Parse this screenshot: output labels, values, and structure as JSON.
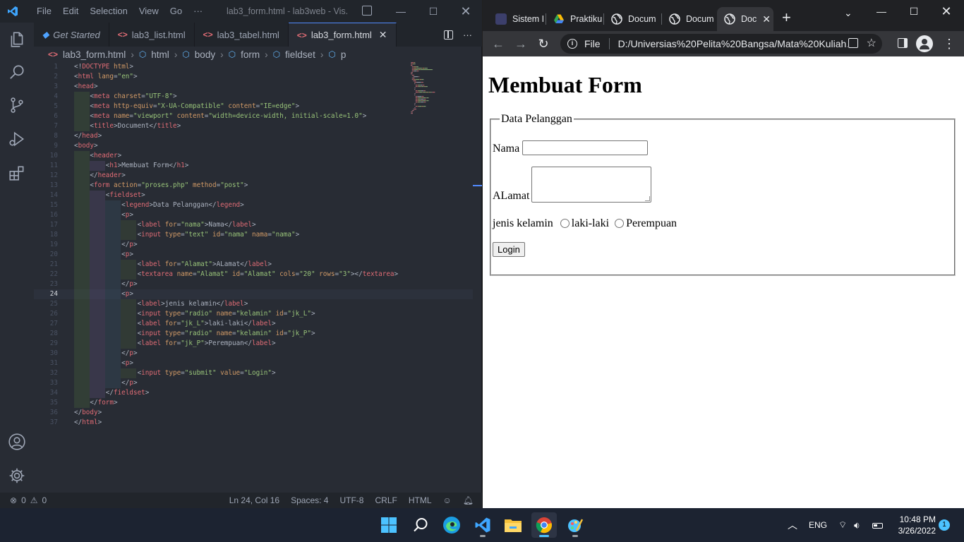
{
  "vscode": {
    "menu": [
      "File",
      "Edit",
      "Selection",
      "View",
      "Go",
      "···"
    ],
    "window_title": "lab3_form.html - lab3web - Vis...",
    "tabs": [
      {
        "label": "Get Started",
        "icon": "vscode-icon",
        "active": false
      },
      {
        "label": "lab3_list.html",
        "icon": "html-icon",
        "active": false
      },
      {
        "label": "lab3_tabel.html",
        "icon": "html-icon",
        "active": false
      },
      {
        "label": "lab3_form.html",
        "icon": "html-icon",
        "active": true
      }
    ],
    "breadcrumb": [
      "lab3_form.html",
      "html",
      "body",
      "form",
      "fieldset",
      "p"
    ],
    "active_line": 24,
    "code_lines": [
      [
        [
          "b",
          "<!"
        ],
        [
          "t",
          "DOCTYPE"
        ],
        [
          "x",
          " "
        ],
        [
          "a",
          "html"
        ],
        [
          "b",
          ">"
        ]
      ],
      [
        [
          "b",
          "<"
        ],
        [
          "t",
          "html"
        ],
        [
          "x",
          " "
        ],
        [
          "a",
          "lang"
        ],
        [
          "b",
          "="
        ],
        [
          "s",
          "\"en\""
        ],
        [
          "b",
          ">"
        ]
      ],
      [
        [
          "b",
          "<"
        ],
        [
          "t",
          "head"
        ],
        [
          "b",
          ">"
        ]
      ],
      [
        [
          "x",
          "    "
        ],
        [
          "b",
          "<"
        ],
        [
          "t",
          "meta"
        ],
        [
          "x",
          " "
        ],
        [
          "a",
          "charset"
        ],
        [
          "b",
          "="
        ],
        [
          "s",
          "\"UTF-8\""
        ],
        [
          "b",
          ">"
        ]
      ],
      [
        [
          "x",
          "    "
        ],
        [
          "b",
          "<"
        ],
        [
          "t",
          "meta"
        ],
        [
          "x",
          " "
        ],
        [
          "a",
          "http-equiv"
        ],
        [
          "b",
          "="
        ],
        [
          "s",
          "\"X-UA-Compatible\""
        ],
        [
          "x",
          " "
        ],
        [
          "a",
          "content"
        ],
        [
          "b",
          "="
        ],
        [
          "s",
          "\"IE=edge\""
        ],
        [
          "b",
          ">"
        ]
      ],
      [
        [
          "x",
          "    "
        ],
        [
          "b",
          "<"
        ],
        [
          "t",
          "meta"
        ],
        [
          "x",
          " "
        ],
        [
          "a",
          "name"
        ],
        [
          "b",
          "="
        ],
        [
          "s",
          "\"viewport\""
        ],
        [
          "x",
          " "
        ],
        [
          "a",
          "content"
        ],
        [
          "b",
          "="
        ],
        [
          "s",
          "\"width=device-width, initial-scale=1.0\""
        ],
        [
          "b",
          ">"
        ]
      ],
      [
        [
          "x",
          "    "
        ],
        [
          "b",
          "<"
        ],
        [
          "t",
          "title"
        ],
        [
          "b",
          ">"
        ],
        [
          "x",
          "Document"
        ],
        [
          "b",
          "</"
        ],
        [
          "t",
          "title"
        ],
        [
          "b",
          ">"
        ]
      ],
      [
        [
          "b",
          "</"
        ],
        [
          "t",
          "head"
        ],
        [
          "b",
          ">"
        ]
      ],
      [
        [
          "b",
          "<"
        ],
        [
          "t",
          "body"
        ],
        [
          "b",
          ">"
        ]
      ],
      [
        [
          "x",
          "    "
        ],
        [
          "b",
          "<"
        ],
        [
          "t",
          "header"
        ],
        [
          "b",
          ">"
        ]
      ],
      [
        [
          "x",
          "        "
        ],
        [
          "b",
          "<"
        ],
        [
          "t",
          "h1"
        ],
        [
          "b",
          ">"
        ],
        [
          "x",
          "Membuat Form"
        ],
        [
          "b",
          "</"
        ],
        [
          "t",
          "h1"
        ],
        [
          "b",
          ">"
        ]
      ],
      [
        [
          "x",
          "    "
        ],
        [
          "b",
          "</"
        ],
        [
          "t",
          "header"
        ],
        [
          "b",
          ">"
        ]
      ],
      [
        [
          "x",
          "    "
        ],
        [
          "b",
          "<"
        ],
        [
          "t",
          "form"
        ],
        [
          "x",
          " "
        ],
        [
          "a",
          "action"
        ],
        [
          "b",
          "="
        ],
        [
          "s",
          "\"proses.php\""
        ],
        [
          "x",
          " "
        ],
        [
          "a",
          "method"
        ],
        [
          "b",
          "="
        ],
        [
          "s",
          "\"post\""
        ],
        [
          "b",
          ">"
        ]
      ],
      [
        [
          "x",
          "        "
        ],
        [
          "b",
          "<"
        ],
        [
          "t",
          "fieldset"
        ],
        [
          "b",
          ">"
        ]
      ],
      [
        [
          "x",
          "            "
        ],
        [
          "b",
          "<"
        ],
        [
          "t",
          "legend"
        ],
        [
          "b",
          ">"
        ],
        [
          "x",
          "Data Pelanggan"
        ],
        [
          "b",
          "</"
        ],
        [
          "t",
          "legend"
        ],
        [
          "b",
          ">"
        ]
      ],
      [
        [
          "x",
          "            "
        ],
        [
          "b",
          "<"
        ],
        [
          "t",
          "p"
        ],
        [
          "b",
          ">"
        ]
      ],
      [
        [
          "x",
          "                "
        ],
        [
          "b",
          "<"
        ],
        [
          "t",
          "label"
        ],
        [
          "x",
          " "
        ],
        [
          "a",
          "for"
        ],
        [
          "b",
          "="
        ],
        [
          "s",
          "\"nama\""
        ],
        [
          "b",
          ">"
        ],
        [
          "x",
          "Nama"
        ],
        [
          "b",
          "</"
        ],
        [
          "t",
          "label"
        ],
        [
          "b",
          ">"
        ]
      ],
      [
        [
          "x",
          "                "
        ],
        [
          "b",
          "<"
        ],
        [
          "t",
          "input"
        ],
        [
          "x",
          " "
        ],
        [
          "a",
          "type"
        ],
        [
          "b",
          "="
        ],
        [
          "s",
          "\"text\""
        ],
        [
          "x",
          " "
        ],
        [
          "a",
          "id"
        ],
        [
          "b",
          "="
        ],
        [
          "s",
          "\"nama\""
        ],
        [
          "x",
          " "
        ],
        [
          "a",
          "nama"
        ],
        [
          "b",
          "="
        ],
        [
          "s",
          "\"nama\""
        ],
        [
          "b",
          ">"
        ]
      ],
      [
        [
          "x",
          "            "
        ],
        [
          "b",
          "</"
        ],
        [
          "t",
          "p"
        ],
        [
          "b",
          ">"
        ]
      ],
      [
        [
          "x",
          "            "
        ],
        [
          "b",
          "<"
        ],
        [
          "t",
          "p"
        ],
        [
          "b",
          ">"
        ]
      ],
      [
        [
          "x",
          "                "
        ],
        [
          "b",
          "<"
        ],
        [
          "t",
          "label"
        ],
        [
          "x",
          " "
        ],
        [
          "a",
          "for"
        ],
        [
          "b",
          "="
        ],
        [
          "s",
          "\"Alamat\""
        ],
        [
          "b",
          ">"
        ],
        [
          "x",
          "ALamat"
        ],
        [
          "b",
          "</"
        ],
        [
          "t",
          "label"
        ],
        [
          "b",
          ">"
        ]
      ],
      [
        [
          "x",
          "                "
        ],
        [
          "b",
          "<"
        ],
        [
          "t",
          "textarea"
        ],
        [
          "x",
          " "
        ],
        [
          "a",
          "name"
        ],
        [
          "b",
          "="
        ],
        [
          "s",
          "\"Alamat\""
        ],
        [
          "x",
          " "
        ],
        [
          "a",
          "id"
        ],
        [
          "b",
          "="
        ],
        [
          "s",
          "\"Alamat\""
        ],
        [
          "x",
          " "
        ],
        [
          "a",
          "cols"
        ],
        [
          "b",
          "="
        ],
        [
          "s",
          "\"20\""
        ],
        [
          "x",
          " "
        ],
        [
          "a",
          "rows"
        ],
        [
          "b",
          "="
        ],
        [
          "s",
          "\"3\""
        ],
        [
          "b",
          "></"
        ],
        [
          "t",
          "textarea"
        ],
        [
          "b",
          ">"
        ]
      ],
      [
        [
          "x",
          "            "
        ],
        [
          "b",
          "</"
        ],
        [
          "t",
          "p"
        ],
        [
          "b",
          ">"
        ]
      ],
      [
        [
          "x",
          "            "
        ],
        [
          "b",
          "<"
        ],
        [
          "t",
          "p"
        ],
        [
          "b",
          ">"
        ]
      ],
      [
        [
          "x",
          "                "
        ],
        [
          "b",
          "<"
        ],
        [
          "t",
          "label"
        ],
        [
          "b",
          ">"
        ],
        [
          "x",
          "jenis kelamin"
        ],
        [
          "b",
          "</"
        ],
        [
          "t",
          "label"
        ],
        [
          "b",
          ">"
        ]
      ],
      [
        [
          "x",
          "                "
        ],
        [
          "b",
          "<"
        ],
        [
          "t",
          "input"
        ],
        [
          "x",
          " "
        ],
        [
          "a",
          "type"
        ],
        [
          "b",
          "="
        ],
        [
          "s",
          "\"radio\""
        ],
        [
          "x",
          " "
        ],
        [
          "a",
          "name"
        ],
        [
          "b",
          "="
        ],
        [
          "s",
          "\"kelamin\""
        ],
        [
          "x",
          " "
        ],
        [
          "a",
          "id"
        ],
        [
          "b",
          "="
        ],
        [
          "s",
          "\"jk_L\""
        ],
        [
          "b",
          ">"
        ]
      ],
      [
        [
          "x",
          "                "
        ],
        [
          "b",
          "<"
        ],
        [
          "t",
          "label"
        ],
        [
          "x",
          " "
        ],
        [
          "a",
          "for"
        ],
        [
          "b",
          "="
        ],
        [
          "s",
          "\"jk_L\""
        ],
        [
          "b",
          ">"
        ],
        [
          "x",
          "laki-laki"
        ],
        [
          "b",
          "</"
        ],
        [
          "t",
          "label"
        ],
        [
          "b",
          ">"
        ]
      ],
      [
        [
          "x",
          "                "
        ],
        [
          "b",
          "<"
        ],
        [
          "t",
          "input"
        ],
        [
          "x",
          " "
        ],
        [
          "a",
          "type"
        ],
        [
          "b",
          "="
        ],
        [
          "s",
          "\"radio\""
        ],
        [
          "x",
          " "
        ],
        [
          "a",
          "name"
        ],
        [
          "b",
          "="
        ],
        [
          "s",
          "\"kelamin\""
        ],
        [
          "x",
          " "
        ],
        [
          "a",
          "id"
        ],
        [
          "b",
          "="
        ],
        [
          "s",
          "\"jk_P\""
        ],
        [
          "b",
          ">"
        ]
      ],
      [
        [
          "x",
          "                "
        ],
        [
          "b",
          "<"
        ],
        [
          "t",
          "label"
        ],
        [
          "x",
          " "
        ],
        [
          "a",
          "for"
        ],
        [
          "b",
          "="
        ],
        [
          "s",
          "\"jk_P\""
        ],
        [
          "b",
          ">"
        ],
        [
          "x",
          "Perempuan"
        ],
        [
          "b",
          "</"
        ],
        [
          "t",
          "label"
        ],
        [
          "b",
          ">"
        ]
      ],
      [
        [
          "x",
          "            "
        ],
        [
          "b",
          "</"
        ],
        [
          "t",
          "p"
        ],
        [
          "b",
          ">"
        ]
      ],
      [
        [
          "x",
          "            "
        ],
        [
          "b",
          "<"
        ],
        [
          "t",
          "p"
        ],
        [
          "b",
          ">"
        ]
      ],
      [
        [
          "x",
          "                "
        ],
        [
          "b",
          "<"
        ],
        [
          "t",
          "input"
        ],
        [
          "x",
          " "
        ],
        [
          "a",
          "type"
        ],
        [
          "b",
          "="
        ],
        [
          "s",
          "\"submit\""
        ],
        [
          "x",
          " "
        ],
        [
          "a",
          "value"
        ],
        [
          "b",
          "="
        ],
        [
          "s",
          "\"Login\""
        ],
        [
          "b",
          ">"
        ]
      ],
      [
        [
          "x",
          "            "
        ],
        [
          "b",
          "</"
        ],
        [
          "t",
          "p"
        ],
        [
          "b",
          ">"
        ]
      ],
      [
        [
          "x",
          "        "
        ],
        [
          "b",
          "</"
        ],
        [
          "t",
          "fieldset"
        ],
        [
          "b",
          ">"
        ]
      ],
      [
        [
          "x",
          "    "
        ],
        [
          "b",
          "</"
        ],
        [
          "t",
          "form"
        ],
        [
          "b",
          ">"
        ]
      ],
      [
        [
          "b",
          "</"
        ],
        [
          "t",
          "body"
        ],
        [
          "b",
          ">"
        ]
      ],
      [
        [
          "b",
          "</"
        ],
        [
          "t",
          "html"
        ],
        [
          "b",
          ">"
        ]
      ]
    ],
    "status": {
      "errors": "0",
      "warnings": "0",
      "position": "Ln 24, Col 16",
      "spaces": "Spaces: 4",
      "encoding": "UTF-8",
      "eol": "CRLF",
      "language": "HTML"
    }
  },
  "chrome": {
    "tabs": [
      {
        "label": "Sistem I",
        "icon": "app-icon"
      },
      {
        "label": "Praktiku",
        "icon": "google-drive-icon"
      },
      {
        "label": "Docum",
        "icon": "globe-icon"
      },
      {
        "label": "Docum",
        "icon": "globe-icon"
      },
      {
        "label": "Doc",
        "icon": "globe-icon",
        "active": true
      }
    ],
    "scheme": "File",
    "url": "D:/Universias%20Pelita%20Bangsa/Mata%20Kuliah...",
    "page": {
      "heading": "Membuat Form",
      "legend": "Data Pelanggan",
      "nama_label": "Nama",
      "alamat_label": "ALamat",
      "gender_label": "jenis kelamin",
      "option_male": "laki-laki",
      "option_female": "Perempuan",
      "submit_label": "Login"
    }
  },
  "taskbar": {
    "apps": [
      "windows-start-icon",
      "search-icon",
      "edge-icon",
      "vscode-icon",
      "file-explorer-icon",
      "chrome-icon",
      "paint-icon"
    ],
    "language": "ENG",
    "time": "10:48 PM",
    "date": "3/26/2022",
    "notifications": "1"
  },
  "colors": {
    "vscode_bg": "#282c34",
    "chrome_dark": "#202124",
    "taskbar": "#1c2331",
    "accent": "#4cc2ff"
  }
}
